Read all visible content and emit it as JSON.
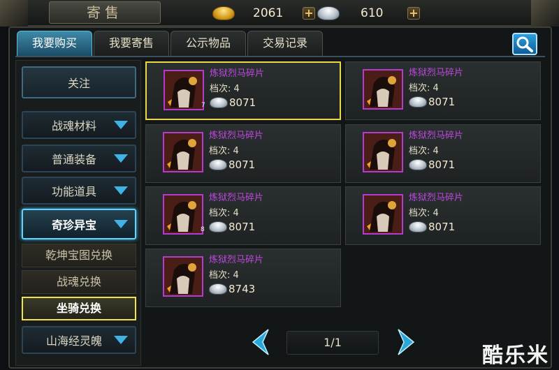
{
  "header": {
    "title": "寄售",
    "gold_amount": "2061",
    "silver_amount": "610"
  },
  "tabs": [
    {
      "label": "我要购买",
      "active": true
    },
    {
      "label": "我要寄售",
      "active": false
    },
    {
      "label": "公示物品",
      "active": false
    },
    {
      "label": "交易记录",
      "active": false
    }
  ],
  "sidebar": {
    "follow": "关注",
    "categories": [
      {
        "label": "战魂材料"
      },
      {
        "label": "普通装备"
      },
      {
        "label": "功能道具"
      },
      {
        "label": "奇珍异宝"
      }
    ],
    "subcategories": [
      {
        "label": "乾坤宝图兑换"
      },
      {
        "label": "战魂兑换"
      },
      {
        "label": "坐骑兑换"
      }
    ],
    "last_category": "山海经灵魄"
  },
  "items": [
    {
      "name": "炼狱烈马碎片",
      "grade": "档次: 4",
      "price": "8071",
      "qty": "7"
    },
    {
      "name": "炼狱烈马碎片",
      "grade": "档次: 4",
      "price": "8071",
      "qty": ""
    },
    {
      "name": "炼狱烈马碎片",
      "grade": "档次: 4",
      "price": "8071",
      "qty": ""
    },
    {
      "name": "炼狱烈马碎片",
      "grade": "档次: 4",
      "price": "8071",
      "qty": ""
    },
    {
      "name": "炼狱烈马碎片",
      "grade": "档次: 4",
      "price": "8071",
      "qty": "8"
    },
    {
      "name": "炼狱烈马碎片",
      "grade": "档次: 4",
      "price": "8071",
      "qty": ""
    },
    {
      "name": "炼狱烈马碎片",
      "grade": "档次: 4",
      "price": "8743",
      "qty": ""
    }
  ],
  "pagination": {
    "page_text": "1/1"
  },
  "watermark": "酷乐米",
  "colors": {
    "accent_blue": "#3fb3e5",
    "selected_gold": "#e8d84a",
    "item_name_purple": "#c04ae0"
  }
}
